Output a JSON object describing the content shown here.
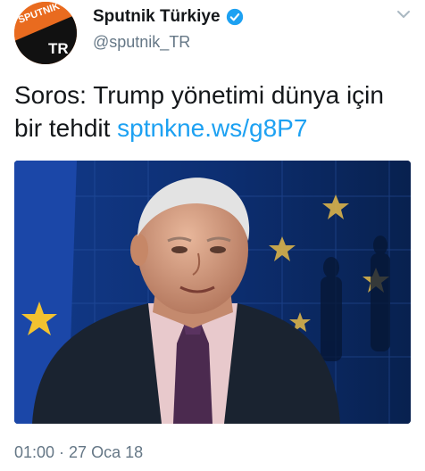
{
  "account": {
    "display_name": "Sputnik Türkiye",
    "handle": "@sputnik_TR",
    "avatar_logo_text": "SPUTNIK",
    "avatar_logo_sub": "TR",
    "verified": true
  },
  "tweet": {
    "text": "Soros: Trump yönetimi dünya için bir tehdit ",
    "link": "sptnkne.ws/g8P7"
  },
  "media": {
    "icon": "photo"
  },
  "meta": {
    "timestamp": "01:00 · 27 Oca 18"
  },
  "colors": {
    "accent": "#1da1f2",
    "brand_orange": "#e96b1f",
    "text": "#14171a",
    "muted": "#657786"
  }
}
